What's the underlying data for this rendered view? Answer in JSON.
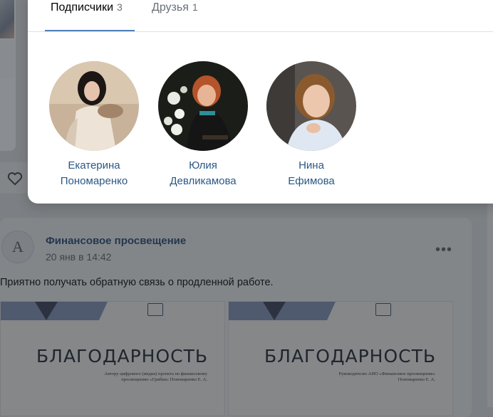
{
  "popup": {
    "tabs": [
      {
        "label": "Подписчики",
        "count": "3",
        "active": true
      },
      {
        "label": "Друзья",
        "count": "1",
        "active": false
      }
    ],
    "people": [
      {
        "first_name": "Екатерина",
        "last_name": "Пономаренко"
      },
      {
        "first_name": "Юлия",
        "last_name": "Девликамова"
      },
      {
        "first_name": "Нина",
        "last_name": "Ефимова"
      }
    ]
  },
  "post": {
    "author": "Финансовое просвещение",
    "date": "20 янв в 14:42",
    "more_icon": "•••",
    "text": "Приятно получать обратную связь о продленной работе.",
    "avatar_letter": "A",
    "documents": [
      {
        "title": "БЛАГОДАРНОСТЬ",
        "subtitle": "Автору цифрового (медиа) проекта по финансовому просвещению «Грибки» Пономаренко Е. А."
      },
      {
        "title": "БЛАГОДАРНОСТЬ",
        "subtitle": "Руководителю АНО «Финансовое просвещение» Пономаренко Е. А."
      }
    ]
  },
  "colors": {
    "accent": "#5181b8",
    "link": "#2a5885",
    "overlay": "#7c7f83"
  }
}
